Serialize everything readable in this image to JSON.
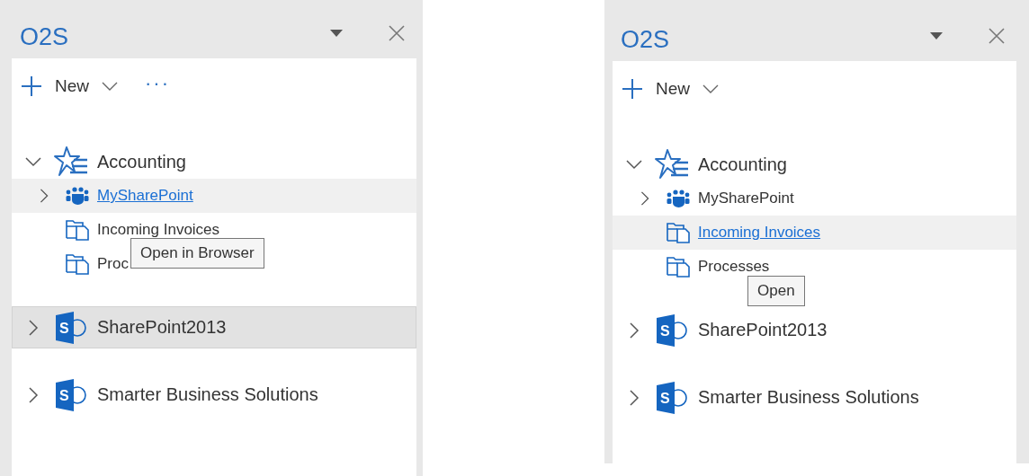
{
  "panels": [
    {
      "title": "O2S",
      "new_button": "New",
      "more_button": "···",
      "items": [
        {
          "kind": "favorites",
          "label": "Accounting",
          "has_children": true,
          "expanded": true,
          "hovered": false,
          "selected": false,
          "children": [
            {
              "kind": "site",
              "label": "MySharePoint",
              "has_children": true,
              "expanded": false,
              "hovered": true,
              "selected": false
            },
            {
              "kind": "library",
              "label": "Incoming Invoices",
              "hovered": false,
              "selected": false,
              "tooltip": "Open in Browser"
            },
            {
              "kind": "library",
              "label": "Proc",
              "hovered": false,
              "selected": false
            }
          ]
        },
        {
          "kind": "sharepoint",
          "logo_text": "S",
          "label": "SharePoint2013",
          "has_children": true,
          "expanded": false,
          "hovered": false,
          "selected": true
        },
        {
          "kind": "sharepoint",
          "logo_text": "S",
          "label": "Smarter Business Solutions",
          "has_children": true,
          "expanded": false,
          "hovered": false,
          "selected": false
        }
      ]
    },
    {
      "title": "O2S",
      "new_button": "New",
      "items": [
        {
          "kind": "favorites",
          "label": "Accounting",
          "has_children": true,
          "expanded": true,
          "hovered": false,
          "selected": false,
          "children": [
            {
              "kind": "site",
              "label": "MySharePoint",
              "has_children": true,
              "expanded": false,
              "hovered": false,
              "selected": false
            },
            {
              "kind": "library",
              "label": "Incoming Invoices",
              "hovered": true,
              "selected": false
            },
            {
              "kind": "library",
              "label": "Processes",
              "hovered": false,
              "selected": false,
              "tooltip": "Open"
            }
          ]
        },
        {
          "kind": "sharepoint",
          "logo_text": "S",
          "label": "SharePoint2013",
          "has_children": true,
          "expanded": false,
          "hovered": false,
          "selected": false
        },
        {
          "kind": "sharepoint",
          "logo_text": "S",
          "label": "Smarter Business Solutions",
          "has_children": true,
          "expanded": false,
          "hovered": false,
          "selected": false
        }
      ]
    }
  ]
}
